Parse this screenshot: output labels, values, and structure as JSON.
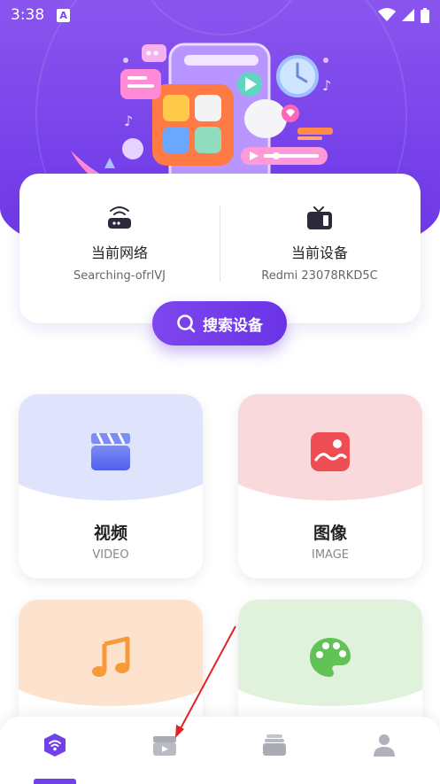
{
  "status_bar": {
    "time": "3:38",
    "notification_letter": "A"
  },
  "info_card": {
    "network": {
      "title": "当前网络",
      "value": "Searching-ofrlVJ",
      "icon": "router-icon"
    },
    "device": {
      "title": "当前设备",
      "value": "Redmi 23078RKD5C",
      "icon": "tv-icon"
    }
  },
  "search_button": {
    "label": "搜索设备",
    "icon": "search-icon"
  },
  "categories": [
    {
      "title": "视频",
      "subtitle": "VIDEO",
      "icon": "clapperboard-icon",
      "color": "#dfe3fb",
      "accent": "#5b6ef0"
    },
    {
      "title": "图像",
      "subtitle": "IMAGE",
      "icon": "image-icon",
      "color": "#f9d9dc",
      "accent": "#ef4d54"
    },
    {
      "title": "",
      "subtitle": "",
      "icon": "music-note-icon",
      "color": "#fde2cd",
      "accent": "#f79a3a"
    },
    {
      "title": "",
      "subtitle": "",
      "icon": "palette-icon",
      "color": "#e0f2db",
      "accent": "#62c257"
    }
  ],
  "bottom_nav": {
    "items": [
      "wifi-cast-icon",
      "clapperboard-icon",
      "stack-icon",
      "user-icon"
    ],
    "active_index": 0
  },
  "colors": {
    "brand": "#7640ea",
    "annotation": "#e02424"
  }
}
